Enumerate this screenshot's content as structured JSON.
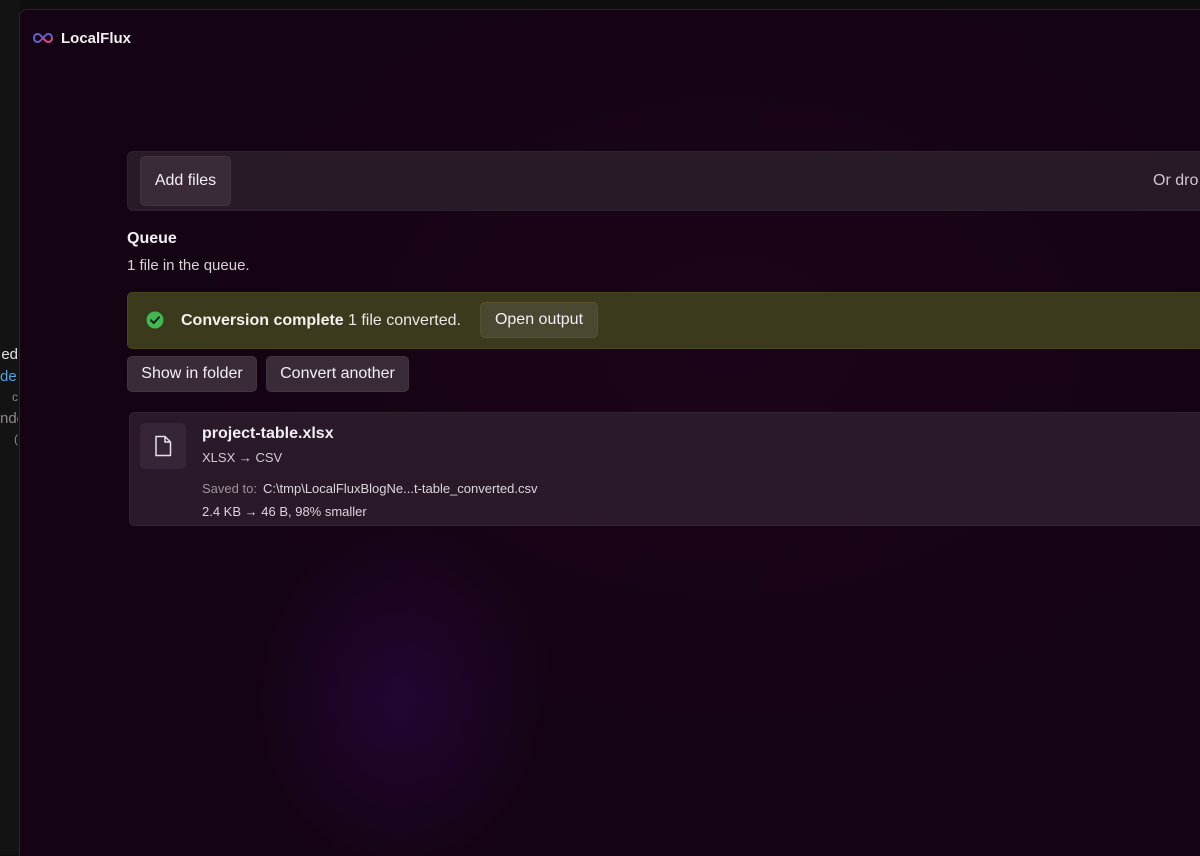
{
  "background_window": {
    "lines": [
      "ed",
      "de,",
      "c",
      "nde",
      "("
    ]
  },
  "app": {
    "title": "LocalFlux",
    "logo_icon": "infinity-logo-icon"
  },
  "dropzone": {
    "add_files_label": "Add files",
    "hint": "Or dro"
  },
  "queue": {
    "title": "Queue",
    "subtitle": "1 file in the queue."
  },
  "status": {
    "icon": "check-circle-icon",
    "title": "Conversion complete",
    "message": "1 file converted.",
    "open_output_label": "Open output",
    "color": "#3b3a1c"
  },
  "actions": {
    "show_in_folder": "Show in folder",
    "convert_another": "Convert another"
  },
  "files": [
    {
      "icon": "document-icon",
      "name": "project-table.xlsx",
      "conversion": "XLSX → CSV",
      "saved_label": "Saved to:",
      "saved_path": "C:\\tmp\\LocalFluxBlogNe...t-table_converted.csv",
      "size_info": "2.4 KB → 46 B, 98% smaller"
    }
  ],
  "colors": {
    "success_check": "#3fb950",
    "accent_link": "#4ea3e0"
  }
}
